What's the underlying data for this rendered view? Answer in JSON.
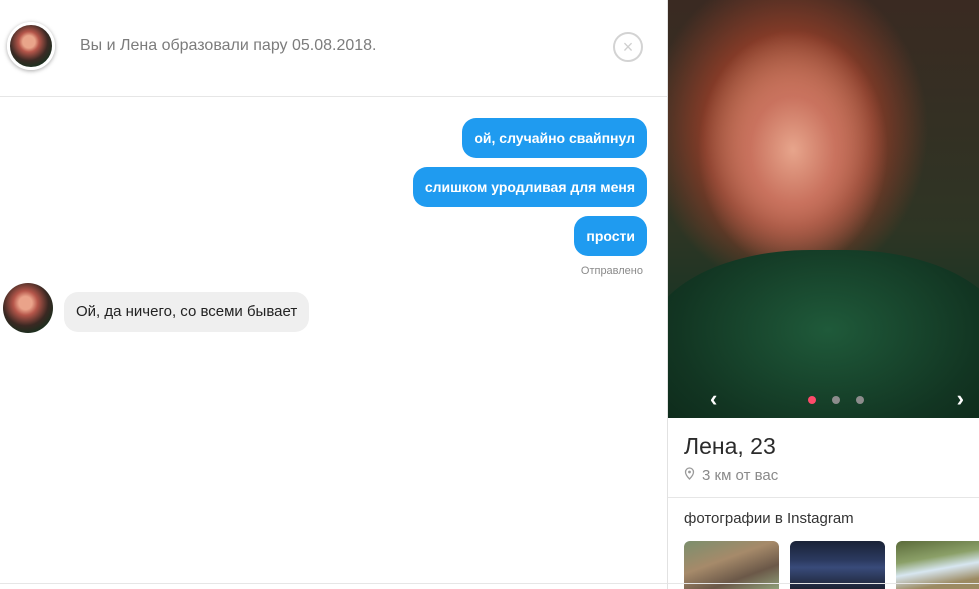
{
  "header": {
    "match_text": "Вы и Лена образовали пару 05.08.2018.",
    "close_icon": "×"
  },
  "messages": [
    {
      "direction": "out",
      "text": "ой, случайно свайпнул"
    },
    {
      "direction": "out",
      "text": "слишком уродливая для меня"
    },
    {
      "direction": "out",
      "text": "прости"
    },
    {
      "direction": "in",
      "text": "Ой, да ничего, со всеми бывает"
    }
  ],
  "status_text": "Отправлено",
  "profile": {
    "name": "Лена, 23",
    "distance": "3 км от вас",
    "nav_prev": "‹",
    "nav_next": "›",
    "photo_count": 3,
    "active_photo_index": 0,
    "instagram_title": "фотографии в Instagram"
  },
  "colors": {
    "outgoing_bubble": "#1f9bf0",
    "incoming_bubble": "#efefef",
    "active_dot": "#fe4a6a"
  }
}
